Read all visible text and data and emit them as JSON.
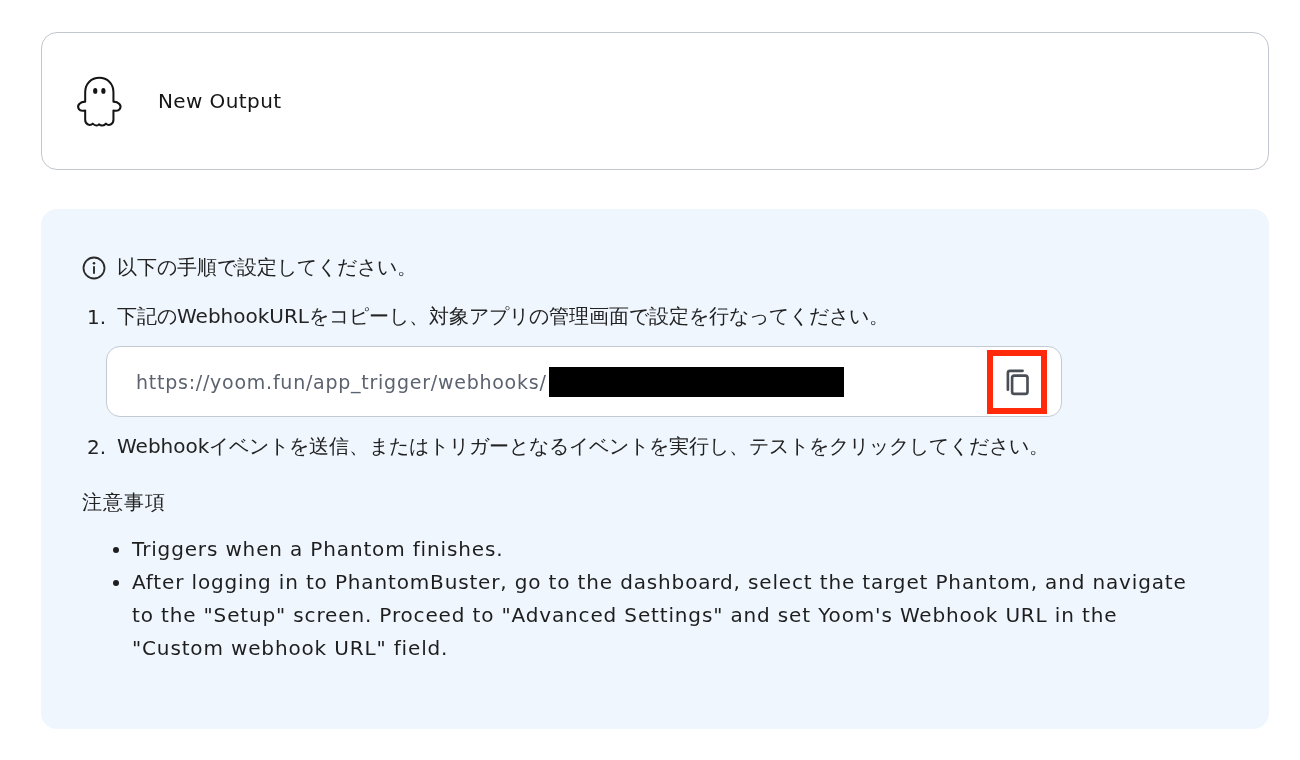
{
  "output_card": {
    "title": "New Output"
  },
  "instructions": {
    "heading": "以下の手順で設定してください。",
    "steps": [
      {
        "number": "1.",
        "text": "下記のWebhookURLをコピーし、対象アプリの管理画面で設定を行なってください。",
        "webhook_field": {
          "value": "https://yoom.fun/app_trigger/webhooks/",
          "redacted": true,
          "copy_button": {
            "highlighted": true
          }
        }
      },
      {
        "number": "2.",
        "text": "Webhookイベントを送信、またはトリガーとなるイベントを実行し、テストをクリックしてください。"
      }
    ],
    "notes": {
      "title": "注意事項",
      "items": [
        "Triggers when a Phantom finishes.",
        "After logging in to PhantomBuster, go to the dashboard, select the target Phantom, and navigate to the \"Setup\" screen. Proceed to \"Advanced Settings\" and set Yoom's Webhook URL in the \"Custom webhook URL\" field."
      ]
    }
  }
}
